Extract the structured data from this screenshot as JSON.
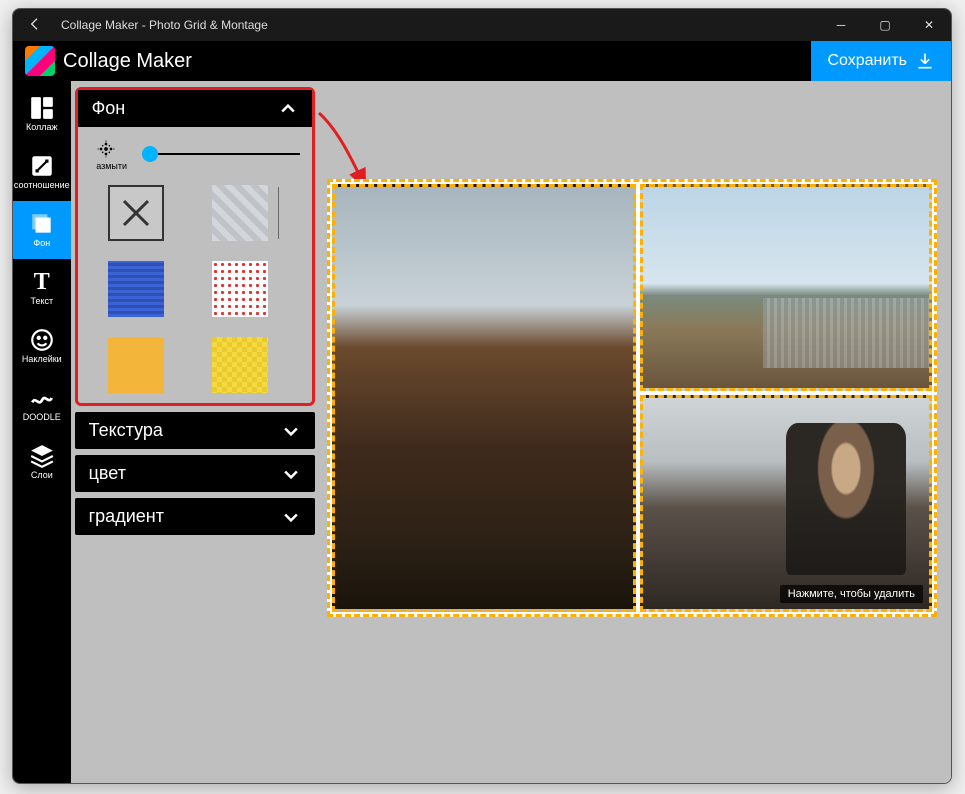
{
  "window": {
    "title": "Collage Maker - Photo Grid & Montage",
    "app_name": "Collage Maker",
    "save_label": "Сохранить"
  },
  "tools": [
    {
      "id": "collage",
      "label": "Коллаж"
    },
    {
      "id": "ratio",
      "label": "соотношение"
    },
    {
      "id": "bg",
      "label": "Фон"
    },
    {
      "id": "text",
      "label": "Текст"
    },
    {
      "id": "stickers",
      "label": "Наклейки"
    },
    {
      "id": "doodle",
      "label": "DOODLE"
    },
    {
      "id": "layers",
      "label": "Слои"
    }
  ],
  "active_tool": "bg",
  "panel": {
    "sections": [
      {
        "id": "bg",
        "label": "Фон",
        "open": true
      },
      {
        "id": "texture",
        "label": "Текстура",
        "open": false
      },
      {
        "id": "color",
        "label": "цвет",
        "open": false
      },
      {
        "id": "gradient",
        "label": "градиент",
        "open": false
      }
    ],
    "blur_label": "азмыти",
    "blur_value": 0.05,
    "swatches": [
      {
        "id": "none",
        "kind": "none"
      },
      {
        "id": "grey3d",
        "kind": "pattern",
        "fill": "repeating-linear-gradient(45deg,#d3d6da 0 6px,#bfc3c8 6px 12px)"
      },
      {
        "id": "blue",
        "kind": "pattern",
        "fill": "repeating-linear-gradient(0deg,#3a63d6 0 3px,#2e50b3 3px 6px),repeating-linear-gradient(90deg,#3a63d6 0 3px,#2e50b3 3px 6px)"
      },
      {
        "id": "reddot",
        "kind": "pattern",
        "fill": "radial-gradient(#d33 1.5px,transparent 1.7px) 0 0/7px 7px,#fff"
      },
      {
        "id": "orange",
        "kind": "solid",
        "fill": "#f3b63b"
      },
      {
        "id": "yellow",
        "kind": "pattern",
        "fill": "repeating-conic-gradient(#f5d941 0 25%,#eacb2e 0 50%) 0 0/10px 10px"
      }
    ]
  },
  "canvas": {
    "tooltip": "Нажмите, чтобы удалить"
  },
  "colors": {
    "accent": "#0099ff",
    "highlight": "#e02020",
    "dash": "#ffb000"
  }
}
